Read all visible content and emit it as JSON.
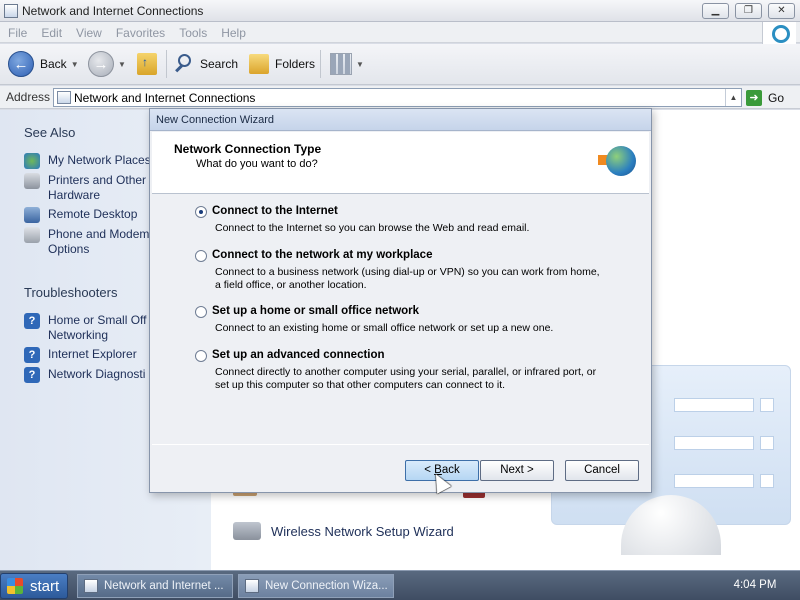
{
  "window": {
    "title": "Network and Internet Connections",
    "buttons": [
      "minimize",
      "restore",
      "close"
    ]
  },
  "menubar": {
    "items": [
      "File",
      "Edit",
      "View",
      "Favorites",
      "Tools",
      "Help"
    ]
  },
  "toolbar": {
    "back_label": "Back",
    "search_label": "Search",
    "folders_label": "Folders"
  },
  "address": {
    "label": "Address",
    "value": "Network and Internet Connections",
    "go_label": "Go"
  },
  "sidebar": {
    "see_also_heading": "See Also",
    "see_also": [
      {
        "label": "My Network Places",
        "icon": "network-places-icon"
      },
      {
        "label": "Printers and Other\nHardware",
        "icon": "printer-icon"
      },
      {
        "label": "Remote Desktop",
        "icon": "remote-desktop-icon"
      },
      {
        "label": "Phone and Modem\nOptions",
        "icon": "phone-icon"
      }
    ],
    "troubleshooters_heading": "Troubleshooters",
    "troubleshooters": [
      {
        "label": "Home or Small Off\nNetworking",
        "icon": "help-icon"
      },
      {
        "label": "Internet Explorer",
        "icon": "help-icon"
      },
      {
        "label": "Network Diagnosti",
        "icon": "help-icon"
      }
    ]
  },
  "content": {
    "wireless_label": "Wireless Network Setup Wizard"
  },
  "wizard": {
    "title": "New Connection Wizard",
    "header_title": "Network Connection Type",
    "header_subtitle": "What do you want to do?",
    "options": [
      {
        "label": "Connect to the Internet",
        "description": "Connect to the Internet so you can browse the Web and read email.",
        "selected": true
      },
      {
        "label": "Connect to the network at my workplace",
        "description": "Connect to a business network (using dial-up or VPN) so you can work from home,\na field office, or another location.",
        "selected": false
      },
      {
        "label": "Set up a home or small office network",
        "description": "Connect to an existing home or small office network or set up a new one.",
        "selected": false
      },
      {
        "label": "Set up an advanced connection",
        "description": "Connect directly to another computer using your serial, parallel, or infrared port, or\nset up this computer so that other computers can connect to it.",
        "selected": false
      }
    ],
    "back_button": {
      "prefix": "< ",
      "accel": "B",
      "rest": "ack"
    },
    "next_button": "Next >",
    "cancel_button": "Cancel"
  },
  "taskbar": {
    "start_label": "start",
    "tasks": [
      "Network and Internet ...",
      "New Connection Wiza..."
    ],
    "clock": "4:04 PM"
  }
}
